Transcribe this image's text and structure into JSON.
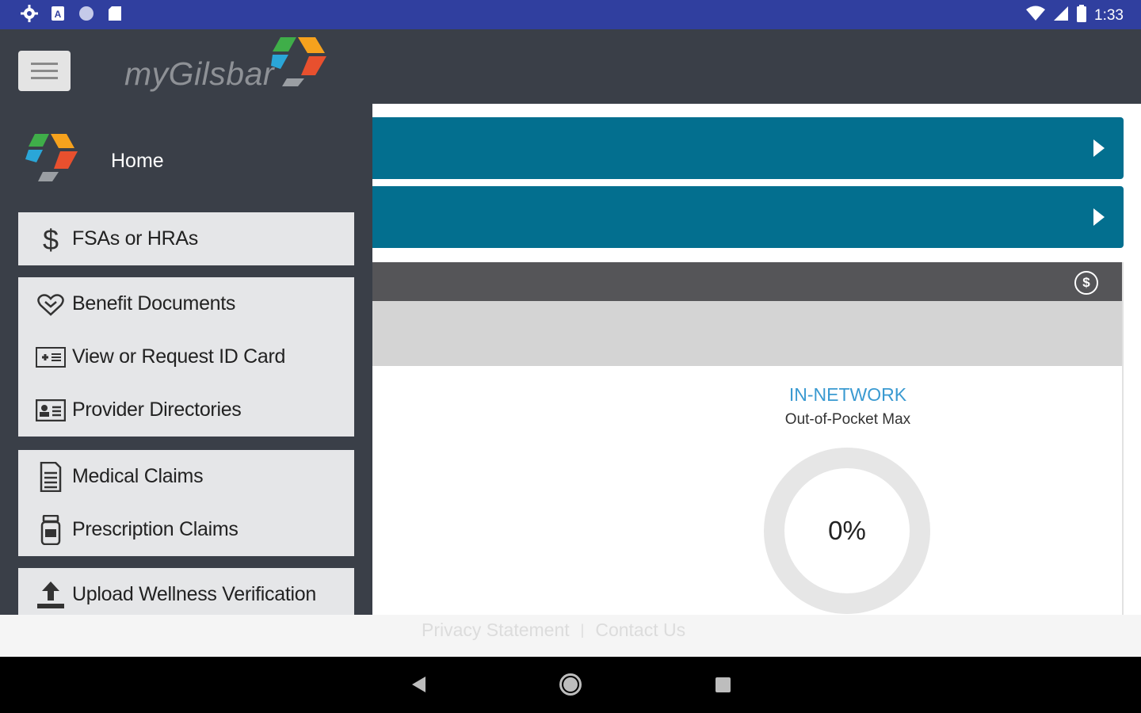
{
  "status_bar": {
    "time": "1:33",
    "icons_left": [
      "settings-icon",
      "a-icon",
      "circle-icon",
      "sd-card-icon"
    ],
    "icons_right": [
      "wifi-icon",
      "signal-icon",
      "battery-icon"
    ]
  },
  "app_bar": {
    "brand": "myGilsbar",
    "menu_icon": "hamburger-icon"
  },
  "drawer": {
    "home_label": "Home",
    "groups": [
      {
        "items": [
          {
            "label": "FSAs or HRAs",
            "icon": "dollar-icon"
          }
        ]
      },
      {
        "items": [
          {
            "label": "Benefit Documents",
            "icon": "heart-hand-icon"
          },
          {
            "label": "View or Request ID Card",
            "icon": "id-card-icon"
          },
          {
            "label": "Provider Directories",
            "icon": "contact-card-icon"
          }
        ]
      },
      {
        "items": [
          {
            "label": "Medical Claims",
            "icon": "document-icon"
          },
          {
            "label": "Prescription Claims",
            "icon": "pill-bottle-icon"
          }
        ]
      },
      {
        "items": [
          {
            "label": "Upload Wellness Verification",
            "icon": "upload-icon"
          }
        ]
      }
    ]
  },
  "main": {
    "card": {
      "header_icon": "dollar-circle-icon",
      "header_symbol": "$",
      "network_title": "IN-NETWORK",
      "network_subtitle": "Out-of-Pocket Max",
      "progress_text": "0%",
      "progress_value": 0
    }
  },
  "footer": {
    "privacy": "Privacy Statement",
    "separator": "|",
    "contact": "Contact Us"
  },
  "colors": {
    "status_bar": "#303f9f",
    "app_bar": "#3a3f48",
    "accent_blue": "#036f8f",
    "network_title": "#3a9ad1"
  }
}
